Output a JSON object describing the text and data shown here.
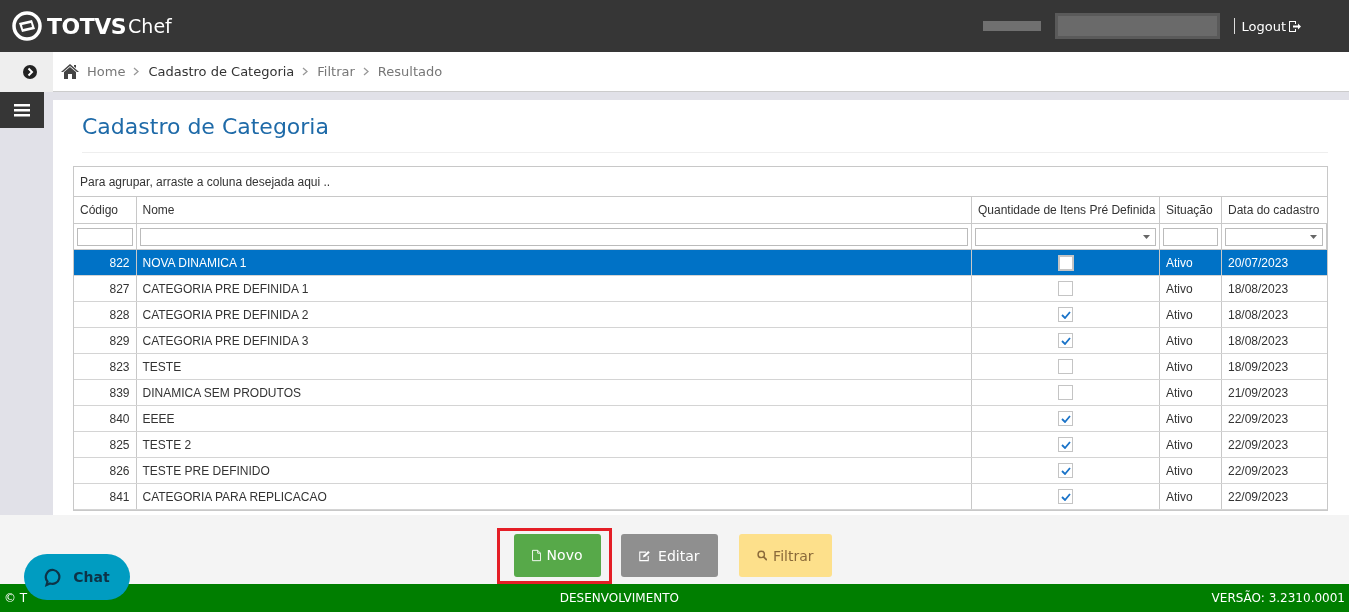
{
  "header": {
    "logo_bold": "TOTVS",
    "logo_light": "Chef",
    "logout": "Logout"
  },
  "breadcrumb": [
    {
      "label": "Home",
      "current": false
    },
    {
      "label": "Cadastro de Categoria",
      "current": true
    },
    {
      "label": "Filtrar",
      "current": false
    },
    {
      "label": "Resultado",
      "current": false
    }
  ],
  "page_title": "Cadastro de Categoria",
  "grid": {
    "group_hint": "Para agrupar, arraste a coluna desejada aqui ..",
    "columns": [
      {
        "label": "Código",
        "kind": "text"
      },
      {
        "label": "Nome",
        "kind": "text"
      },
      {
        "label": "Quantidade de Itens Pré Definida",
        "kind": "dropdown"
      },
      {
        "label": "Situação",
        "kind": "text"
      },
      {
        "label": "Data do cadastro",
        "kind": "dropdown"
      }
    ],
    "rows": [
      {
        "code": "822",
        "name": "NOVA DINAMICA 1",
        "predefined": false,
        "status": "Ativo",
        "date": "20/07/2023",
        "selected": true
      },
      {
        "code": "827",
        "name": "CATEGORIA PRE DEFINIDA 1",
        "predefined": false,
        "status": "Ativo",
        "date": "18/08/2023",
        "selected": false
      },
      {
        "code": "828",
        "name": "CATEGORIA PRE DEFINIDA 2",
        "predefined": true,
        "status": "Ativo",
        "date": "18/08/2023",
        "selected": false
      },
      {
        "code": "829",
        "name": "CATEGORIA PRE DEFINIDA 3",
        "predefined": true,
        "status": "Ativo",
        "date": "18/08/2023",
        "selected": false
      },
      {
        "code": "823",
        "name": "TESTE",
        "predefined": false,
        "status": "Ativo",
        "date": "18/09/2023",
        "selected": false
      },
      {
        "code": "839",
        "name": "DINAMICA SEM PRODUTOS",
        "predefined": false,
        "status": "Ativo",
        "date": "21/09/2023",
        "selected": false
      },
      {
        "code": "840",
        "name": "EEEE",
        "predefined": true,
        "status": "Ativo",
        "date": "22/09/2023",
        "selected": false
      },
      {
        "code": "825",
        "name": "TESTE 2",
        "predefined": true,
        "status": "Ativo",
        "date": "22/09/2023",
        "selected": false
      },
      {
        "code": "826",
        "name": "TESTE PRE DEFINIDO",
        "predefined": true,
        "status": "Ativo",
        "date": "22/09/2023",
        "selected": false
      },
      {
        "code": "841",
        "name": "CATEGORIA PARA REPLICACAO",
        "predefined": true,
        "status": "Ativo",
        "date": "22/09/2023",
        "selected": false
      }
    ]
  },
  "actions": [
    {
      "kind": "new",
      "label": "Novo",
      "highlighted": true
    },
    {
      "kind": "edit",
      "label": "Editar",
      "highlighted": false
    },
    {
      "kind": "filter",
      "label": "Filtrar",
      "highlighted": false
    }
  ],
  "chat": {
    "label": "Chat"
  },
  "footer": {
    "copyright": "© T",
    "environment": "DESENVOLVIMENTO",
    "version": "VERSÃO: 3.2310.0001"
  }
}
